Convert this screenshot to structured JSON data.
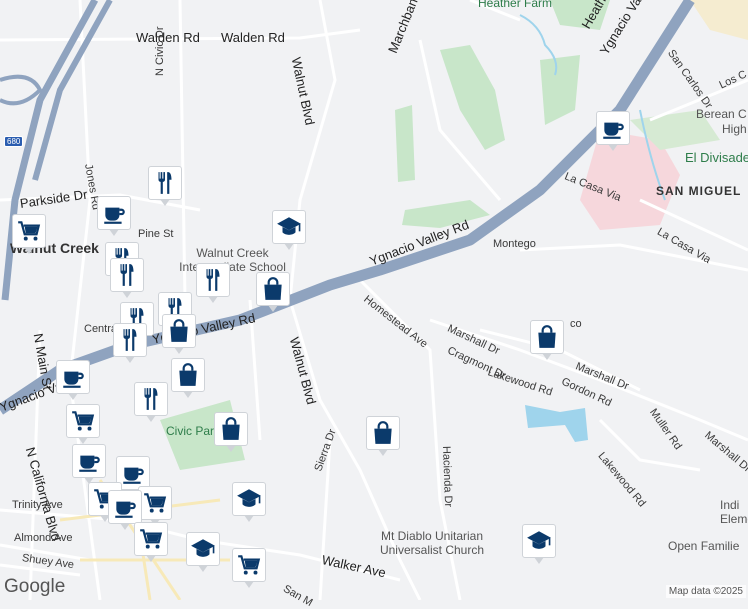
{
  "map": {
    "attribution": "Map data ©2025",
    "logo_text": "Google",
    "colors": {
      "background": "#f1f2f4",
      "major_road": "#8fa3bf",
      "minor_road": "#ffffff",
      "park": "#c8e6c9",
      "water": "#9fd4ec",
      "district": "#f6d7dc",
      "marker_icon": "#0b3a6b"
    }
  },
  "labels": {
    "walden_rd_a": "Walden Rd",
    "walden_rd_b": "Walden Rd",
    "n_civic_dr": "N Civic Dr",
    "walnut_blvd_n": "Walnut Blvd",
    "walnut_blvd_s": "Walnut Blvd",
    "marchbanks_dr": "Marchbanks Dr",
    "heather_farm": "Heather Farm",
    "heather_dr": "Heather Dr",
    "ygnacio_valley_ne": "Ygnacio Valley Rd",
    "ygnacio_valley_mid": "Ygnacio Valley Rd",
    "ygnacio_valley_w": "Ygnacio Valley Rd",
    "ygnacio_valley_sw": "Ygnacio Va",
    "san_carlos_dr": "San Carlos Dr",
    "los_c": "Los C",
    "berean": "Berean C",
    "high": "High",
    "el_divisadero": "El Divisadero",
    "san_miguel": "SAN MIGUEL",
    "la_casa_via_a": "La Casa Via",
    "la_casa_via_b": "La Casa Via",
    "jones_rd": "Jones Rd",
    "parkside_dr": "Parkside Dr",
    "pine_st": "Pine St",
    "walnut_creek": "Walnut Creek",
    "intermediate_school": "Walnut Creek\nIntermediate School",
    "montego": "Montego",
    "homestead_ave": "Homestead Ave",
    "marshall_dr_a": "Marshall Dr",
    "marshall_dr_b": "Marshall Dr",
    "marshall_dr_c": "Marshall Dr",
    "cragmont_dr": "Cragmont Dr",
    "lakewood_rd_a": "Lakewood Rd",
    "lakewood_rd_b": "Lakewood Rd",
    "gordon_rd": "Gordon Rd",
    "muller_rd": "Muller Rd",
    "n_main_st": "N Main St",
    "n_california_blvd": "N California Blvd",
    "central": "Centra",
    "civic_park": "Civic Park",
    "hacienda_dr": "Hacienda Dr",
    "sierra_dr": "Sierra Dr",
    "trinity_ave": "Trinity Ave",
    "almond_ave": "Almond Ave",
    "shuey_ave": "Shuey Ave",
    "walker_ave": "Walker Ave",
    "unitarian": "Mt Diablo Unitarian\nUniversalist Church",
    "indi_elementa": "Indi\nElementa",
    "open_families": "Open Familie",
    "hwy_680": "680",
    "san_m": "San M",
    "co_frag": "co"
  },
  "markers": [
    {
      "type": "cafe",
      "icon": "coffee-cup-icon"
    },
    {
      "type": "restaurant",
      "icon": "fork-knife-icon"
    },
    {
      "type": "grocery",
      "icon": "shopping-cart-icon"
    },
    {
      "type": "shopping",
      "icon": "shopping-bag-icon"
    },
    {
      "type": "school",
      "icon": "graduation-cap-icon"
    }
  ]
}
